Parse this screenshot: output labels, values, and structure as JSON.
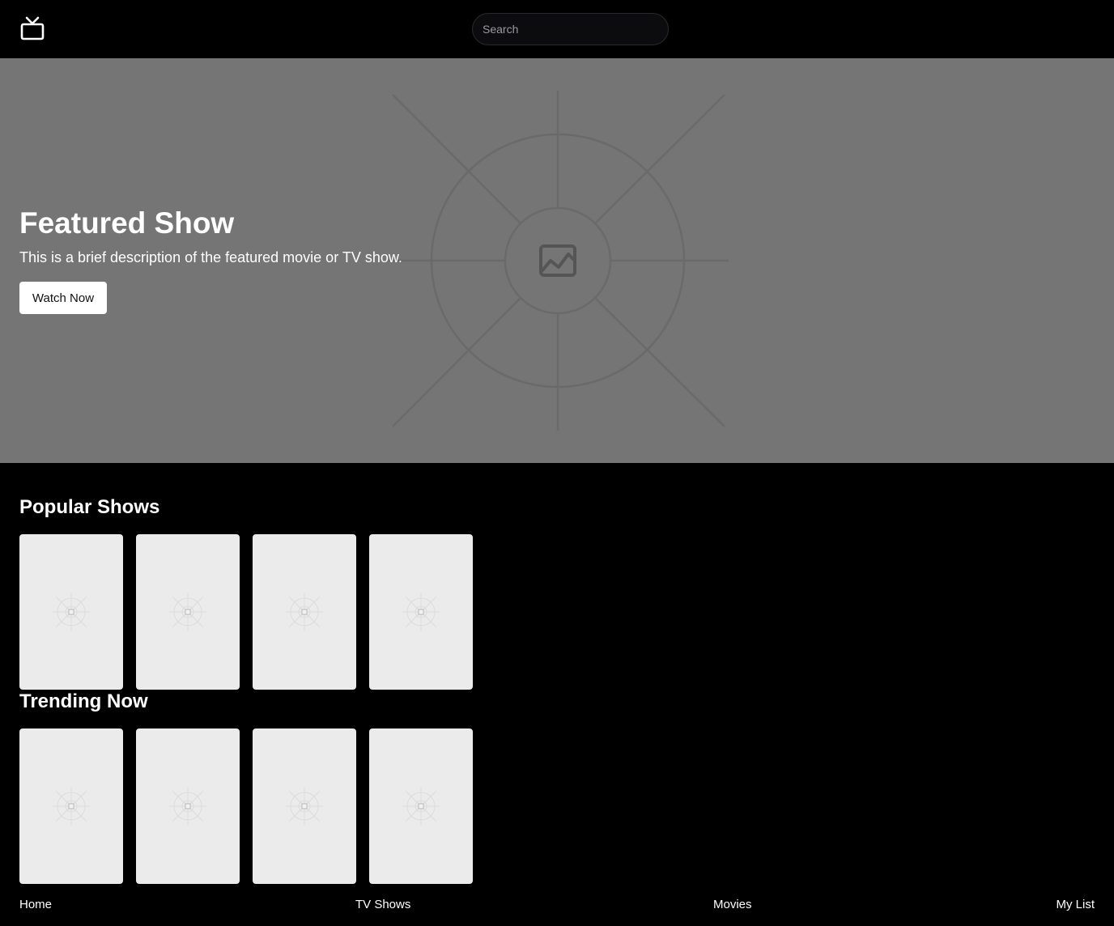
{
  "header": {
    "logo_icon": "tv-icon",
    "search": {
      "placeholder": "Search",
      "value": ""
    }
  },
  "hero": {
    "title": "Featured Show",
    "description": "This is a brief description of the featured movie or TV show.",
    "button_label": "Watch Now",
    "image_icon": "image-placeholder-icon",
    "background_color": "#757575"
  },
  "sections": [
    {
      "title": "Popular Shows",
      "cards": 4
    },
    {
      "title": "Trending Now",
      "cards": 4
    }
  ],
  "footer": {
    "links": [
      "Home",
      "TV Shows",
      "Movies",
      "My List"
    ]
  },
  "colors": {
    "background": "#000000",
    "card": "#ebebeb",
    "button": "#ffffff"
  }
}
